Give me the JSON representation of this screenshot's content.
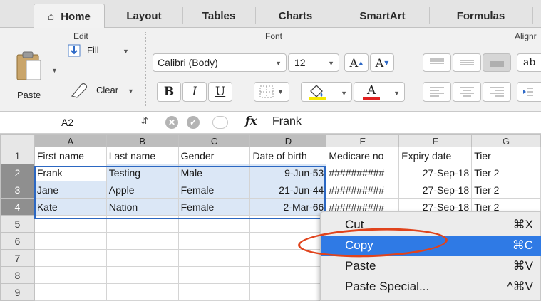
{
  "tabs": [
    {
      "label": "Home"
    },
    {
      "label": "Layout"
    },
    {
      "label": "Tables"
    },
    {
      "label": "Charts"
    },
    {
      "label": "SmartArt"
    },
    {
      "label": "Formulas"
    }
  ],
  "ribbon": {
    "edit_group": "Edit",
    "font_group": "Font",
    "align_group": "Alignr",
    "paste_label": "Paste",
    "fill_label": "Fill",
    "clear_label": "Clear",
    "font_name": "Calibri (Body)",
    "font_size": "12",
    "grow_label": "A",
    "shrink_label": "A",
    "bold_label": "B",
    "italic_label": "I",
    "underline_label": "U",
    "font_color_label": "A",
    "wrap_label": "ab",
    "fill_color": "#f5e800",
    "font_color": "#e02020"
  },
  "formula_bar": {
    "cell_ref": "A2",
    "fx_label": "fx",
    "value": "Frank"
  },
  "grid": {
    "columns": [
      "A",
      "B",
      "C",
      "D",
      "E",
      "F",
      "G"
    ],
    "rows": [
      {
        "num": "1",
        "cells": [
          "First name",
          "Last name",
          "Gender",
          "Date of birth",
          "Medicare no",
          "Expiry date",
          "Tier"
        ]
      },
      {
        "num": "2",
        "cells": [
          "Frank",
          "Testing",
          "Male",
          "9-Jun-53",
          "##########",
          "27-Sep-18",
          "Tier 2"
        ]
      },
      {
        "num": "3",
        "cells": [
          "Jane",
          "Apple",
          "Female",
          "21-Jun-44",
          "##########",
          "27-Sep-18",
          "Tier 2"
        ]
      },
      {
        "num": "4",
        "cells": [
          "Kate",
          "Nation",
          "Female",
          "2-Mar-66",
          "##########",
          "27-Sep-18",
          "Tier 2"
        ]
      },
      {
        "num": "5",
        "cells": [
          "",
          "",
          "",
          "",
          "",
          "",
          ""
        ]
      },
      {
        "num": "6",
        "cells": [
          "",
          "",
          "",
          "",
          "",
          "",
          ""
        ]
      },
      {
        "num": "7",
        "cells": [
          "",
          "",
          "",
          "",
          "",
          "",
          ""
        ]
      },
      {
        "num": "8",
        "cells": [
          "",
          "",
          "",
          "",
          "",
          "",
          ""
        ]
      },
      {
        "num": "9",
        "cells": [
          "",
          "",
          "",
          "",
          "",
          "",
          ""
        ]
      }
    ]
  },
  "context_menu": {
    "items": [
      {
        "label": "Cut",
        "shortcut": "⌘X"
      },
      {
        "label": "Copy",
        "shortcut": "⌘C"
      },
      {
        "label": "Paste",
        "shortcut": "⌘V"
      },
      {
        "label": "Paste Special...",
        "shortcut": "^⌘V"
      }
    ],
    "highlight_color": "#2f7ae5",
    "annotation_color": "#e0431c"
  }
}
